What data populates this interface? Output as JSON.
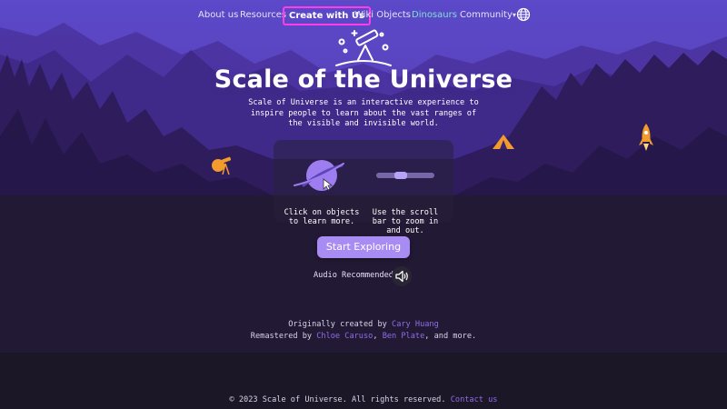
{
  "nav": {
    "about": "About us",
    "resources": "Resources",
    "create": "Create with Us",
    "wiki": "Wiki Objects",
    "dinosaurs": "Dinosaurs",
    "community": "Community"
  },
  "hero": {
    "title": "Scale of the Universe",
    "subtitle": "Scale of Universe is an interactive experience to inspire people to learn about the vast ranges of the visible and invisible world."
  },
  "instructions": {
    "click_text": "Click on objects to learn more.",
    "scroll_text": "Use the scroll bar to zoom in and out."
  },
  "cta": {
    "start_label": "Start Exploring",
    "audio_text": "Audio Recommended"
  },
  "credits": {
    "line1_prefix": "Originally created by ",
    "creator": "Cary Huang",
    "line2_prefix": "Remastered by ",
    "person1": "Chloe Caruso",
    "sep": ", ",
    "person2": "Ben Plate",
    "line2_suffix": ", and more."
  },
  "footer": {
    "copyright": "© 2023 Scale of Universe. All rights reserved.",
    "contact": "Contact us"
  },
  "colors": {
    "accent": "#a98cf3",
    "link": "#8f6ce8",
    "create_border": "#ff3ce6",
    "dinosaurs": "#7fe0d2",
    "sky_top": "#5a48c8",
    "ground": "#201a30"
  },
  "icons": [
    "telescope-icon",
    "globe-icon",
    "chevron-down-icon",
    "planet-icon",
    "cursor-icon",
    "scroll-bar-icon",
    "speaker-icon",
    "tent-icon",
    "rocket-icon",
    "explorer-icon"
  ]
}
